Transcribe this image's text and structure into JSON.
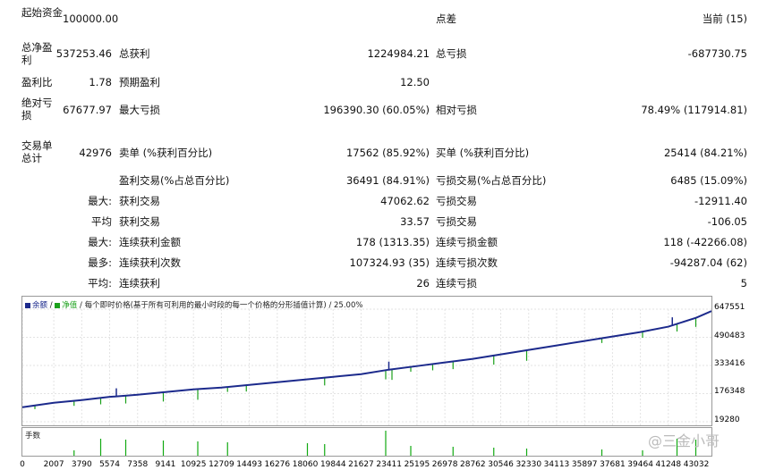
{
  "report": {
    "initial_deposit_label": "起始资金",
    "initial_deposit": "100000.00",
    "spread_label": "点差",
    "spread": "当前 (15)",
    "net_profit_label": "总净盈利",
    "net_profit": "537253.46",
    "gross_profit_label": "总获利",
    "gross_profit": "1224984.21",
    "gross_loss_label": "总亏损",
    "gross_loss": "-687730.75",
    "profit_factor_label": "盈利比",
    "profit_factor": "1.78",
    "expected_payoff_label": "预期盈利",
    "expected_payoff": "12.50",
    "abs_drawdown_label": "绝对亏损",
    "abs_drawdown": "67677.97",
    "max_drawdown_label": "最大亏损",
    "max_drawdown": "196390.30 (60.05%)",
    "rel_drawdown_label": "相对亏损",
    "rel_drawdown": "78.49% (117914.81)",
    "total_trades_label": "交易单总计",
    "total_trades": "42976",
    "short_label": "卖单 (%获利百分比)",
    "short_value": "17562 (85.92%)",
    "long_label": "买单 (%获利百分比)",
    "long_value": "25414 (84.21%)",
    "profit_trades_label": "盈利交易(%占总百分比)",
    "profit_trades": "36491 (84.91%)",
    "loss_trades_label": "亏损交易(%占总百分比)",
    "loss_trades": "6485 (15.09%)",
    "largest_prefix": "最大:",
    "largest_profit_label": "获利交易",
    "largest_profit": "47062.62",
    "largest_loss_label": "亏损交易",
    "largest_loss": "-12911.40",
    "average_prefix": "平均",
    "avg_profit_label": "获利交易",
    "avg_profit": "33.57",
    "avg_loss_label": "亏损交易",
    "avg_loss": "-106.05",
    "max_prefix": "最大:",
    "cons_wins_money_label": "连续获利金额",
    "cons_wins_money": "178 (1313.35)",
    "cons_losses_money_label": "连续亏损金额",
    "cons_losses_money": "118 (-42266.08)",
    "maximal_prefix": "最多:",
    "cons_profit_count_label": "连续获利次数",
    "cons_profit_count": "107324.93 (35)",
    "cons_loss_count_label": "连续亏损次数",
    "cons_loss_count": "-94287.04 (62)",
    "avg2_prefix": "平均:",
    "avg_cons_wins_label": "连续获利",
    "avg_cons_wins": "26",
    "avg_cons_losses_label": "连续亏损",
    "avg_cons_losses": "5"
  },
  "chart_header": {
    "balance_label": "余额",
    "equity_label": "净值",
    "model_text": "每个即时价格(基于所有可利用的最小时段的每一个价格的分形插值计算)",
    "quality": "25.00%"
  },
  "volume_label": "手数",
  "watermark": "@三金小哥",
  "colors": {
    "balance": "#1c2a8c",
    "equity": "#1aa01a",
    "volume": "#11aa11"
  },
  "chart_data": {
    "type": "line",
    "yticks": [
      19280,
      176348,
      333416,
      490483,
      647551
    ],
    "xticks": [
      0,
      2007,
      3790,
      5574,
      7358,
      9141,
      10925,
      12709,
      14493,
      16276,
      18060,
      19844,
      21627,
      23411,
      25195,
      26978,
      28762,
      30546,
      32330,
      34113,
      35897,
      37681,
      39464,
      41248,
      43032
    ],
    "ylim": [
      19280,
      647551
    ],
    "xlim": [
      0,
      44000
    ],
    "series": [
      {
        "name": "余额",
        "x": [
          0,
          2007,
          3790,
          5574,
          7358,
          9141,
          10925,
          12709,
          14493,
          16276,
          18060,
          19844,
          21627,
          23411,
          25195,
          26978,
          28762,
          30546,
          32330,
          34113,
          35897,
          37681,
          39464,
          41248,
          43032,
          44000
        ],
        "y": [
          100000,
          125000,
          140000,
          158000,
          170000,
          185000,
          200000,
          210000,
          225000,
          240000,
          255000,
          270000,
          285000,
          310000,
          330000,
          350000,
          370000,
          395000,
          420000,
          445000,
          470000,
          495000,
          520000,
          550000,
          600000,
          637000
        ]
      }
    ]
  }
}
